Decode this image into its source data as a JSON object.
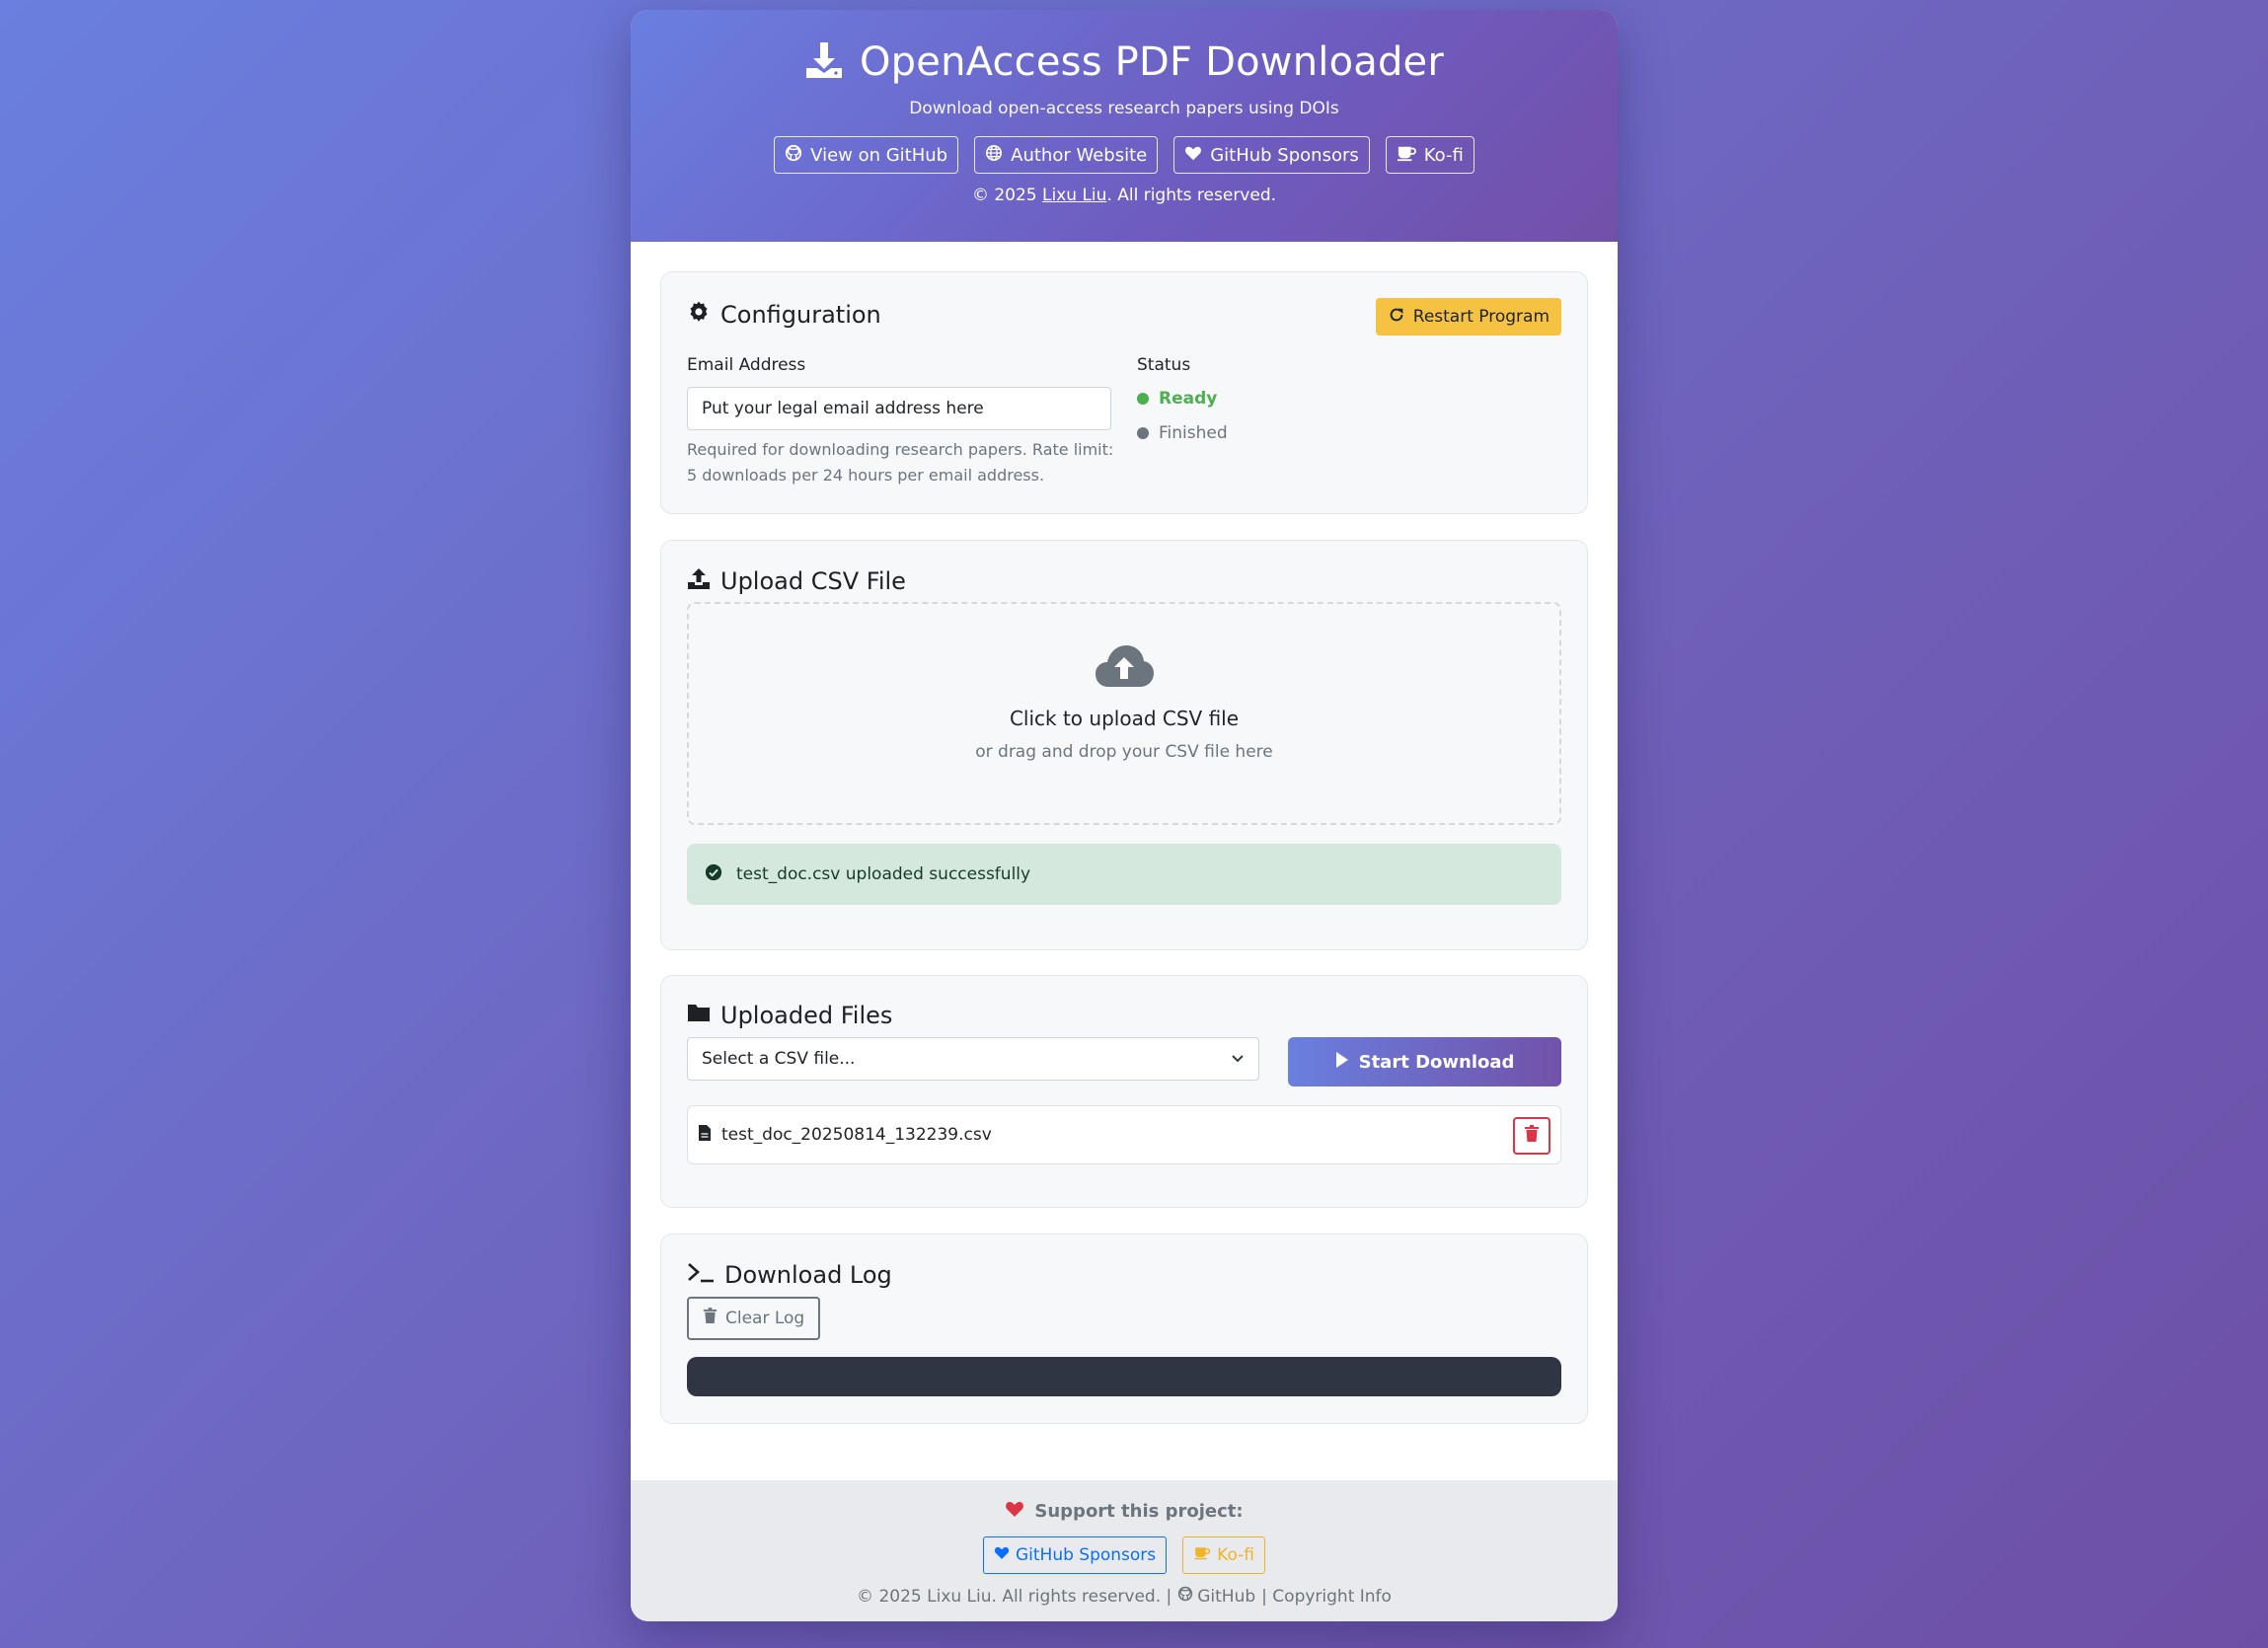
{
  "header": {
    "title": "OpenAccess PDF Downloader",
    "subtitle": "Download open-access research papers using DOIs",
    "links": [
      "View on GitHub",
      "Author Website",
      "GitHub Sponsors",
      "Ko-fi"
    ],
    "copyright_prefix": "© 2025 ",
    "copyright_name": "Lixu Liu",
    "copyright_suffix": ". All rights reserved."
  },
  "config": {
    "title": "Configuration",
    "restart_label": "Restart Program",
    "email_label": "Email Address",
    "email_value": "Put your legal email address here",
    "help_line1": "Required for downloading research papers. Rate limit:",
    "help_line2": "5 downloads per 24 hours per email address.",
    "status_label": "Status",
    "status_ready": "Ready",
    "status_finished": "Finished"
  },
  "upload": {
    "title": "Upload CSV File",
    "drop_main": "Click to upload CSV file",
    "drop_sub": "or drag and drop your CSV file here",
    "alert": "test_doc.csv uploaded successfully"
  },
  "files": {
    "title": "Uploaded Files",
    "select_placeholder": "Select a CSV file...",
    "start_label": "Start Download",
    "items": [
      "test_doc_20250814_132239.csv"
    ]
  },
  "log": {
    "title": "Download Log",
    "clear_label": "Clear Log"
  },
  "footer": {
    "support": "Support this project:",
    "btn_sponsors": "GitHub Sponsors",
    "btn_kofi": "Ko-fi",
    "copy_main": "© 2025 Lixu Liu. All rights reserved. |",
    "copy_github": "GitHub",
    "copy_info": "| Copyright Info"
  },
  "colors": {
    "accent": "#6a7fdf",
    "success": "#4caf50",
    "danger": "#dc3545",
    "warning": "#f5c242",
    "sponsor_blue": "#0d6efd",
    "kofi_yellow": "#f0b429"
  }
}
